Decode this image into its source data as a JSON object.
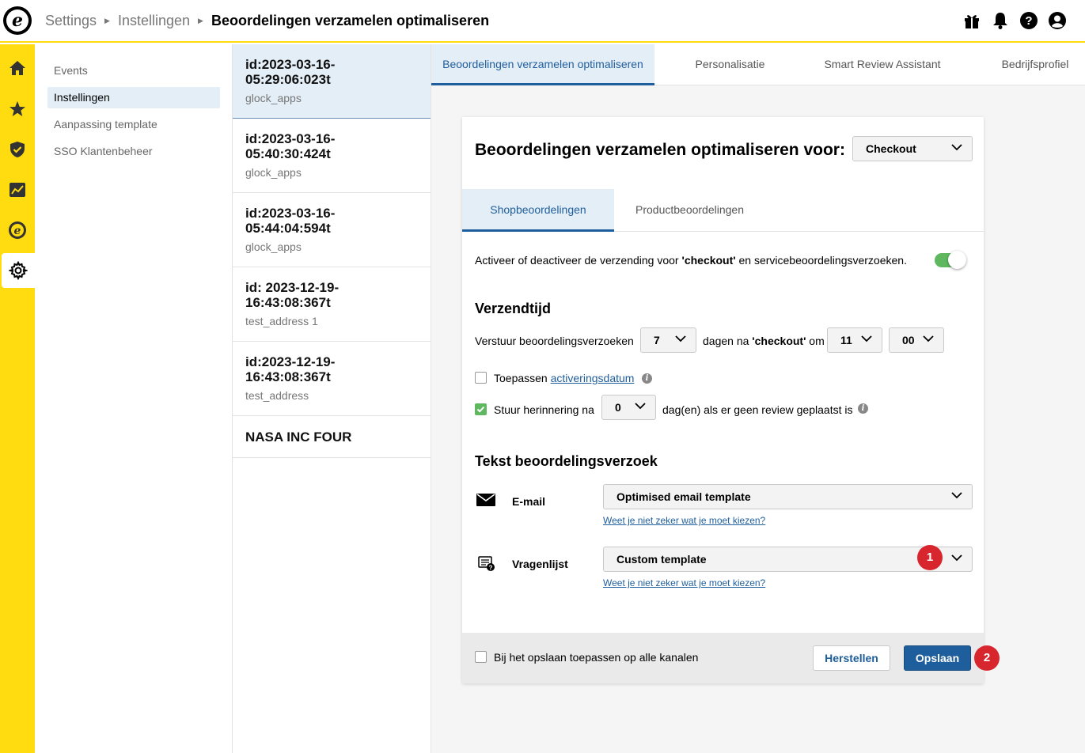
{
  "breadcrumb": {
    "items": [
      "Settings",
      "Instellingen"
    ],
    "current": "Beoordelingen verzamelen optimaliseren"
  },
  "logo_letter": "e",
  "top_icons": [
    "gift-icon",
    "bell-icon",
    "help-icon",
    "account-icon"
  ],
  "rail": [
    "home-icon",
    "star-icon",
    "shield-icon",
    "analytics-icon",
    "trusted-e-icon",
    "gear-icon"
  ],
  "subnav": {
    "items": [
      "Events",
      "Instellingen",
      "Aanpassing template",
      "SSO Klantenbeheer"
    ],
    "active": "Instellingen"
  },
  "accounts": [
    {
      "id": "id:2023-03-16-\n05:29:06:023t",
      "id_line1": "id:2023-03-16-",
      "id_line2": "05:29:06:023t",
      "sub": "glock_apps"
    },
    {
      "id_line1": "id:2023-03-16-",
      "id_line2": "05:40:30:424t",
      "sub": "glock_apps"
    },
    {
      "id_line1": "id:2023-03-16-",
      "id_line2": "05:44:04:594t",
      "sub": "glock_apps"
    },
    {
      "id_line1": "id: 2023-12-19-",
      "id_line2": "16:43:08:367t",
      "sub": "test_address 1"
    },
    {
      "id_line1": "id:2023-12-19-",
      "id_line2": "16:43:08:367t",
      "sub": "test_address"
    },
    {
      "id_line1": "NASA INC FOUR"
    }
  ],
  "tabs": [
    "Beoordelingen verzamelen optimaliseren",
    "Personalisatie",
    "Smart Review Assistant",
    "Bedrijfsprofiel"
  ],
  "card": {
    "title": "Beoordelingen verzamelen optimaliseren voor:",
    "channel_select": "Checkout",
    "inner_tabs": [
      "Shopbeoordelingen",
      "Productbeoordelingen"
    ],
    "activate_text_pre": "Activeer of deactiveer de verzending voor ",
    "activate_text_bold": "'checkout'",
    "activate_text_post": " en servicebeoordelingsverzoeken.",
    "toggle_on": true,
    "verzendtijd_title": "Verzendtijd",
    "send_label": "Verstuur beoordelingsverzoeken",
    "days_value": "7",
    "days_after_pre": "dagen na ",
    "days_after_bold": "'checkout'",
    "days_after_post": " om",
    "hour_value": "11",
    "minute_value": "00",
    "apply_label": "Toepassen ",
    "apply_link": "activeringsdatum",
    "reminder_label": "Stuur herinnering na",
    "reminder_value": "0",
    "reminder_after": "dag(en) als er geen review geplaatst is",
    "reminder_checked": true,
    "info_glyph": "i",
    "text_title": "Tekst beoordelingsverzoek",
    "email_label": "E-mail",
    "email_select": "Optimised email template",
    "help_link": "Weet je niet zeker wat je moet kiezen?",
    "survey_label": "Vragenlijst",
    "survey_select": "Custom template",
    "badge1": "1",
    "badge2": "2",
    "footer_checkbox_label": "Bij het opslaan toepassen op alle kanalen",
    "reset_button": "Herstellen",
    "save_button": "Opslaan"
  },
  "colors": {
    "accent_yellow": "#ffdc0f",
    "primary_blue": "#1f5e9c",
    "toggle_green": "#5fb85f",
    "badge_red": "#d8262f"
  }
}
